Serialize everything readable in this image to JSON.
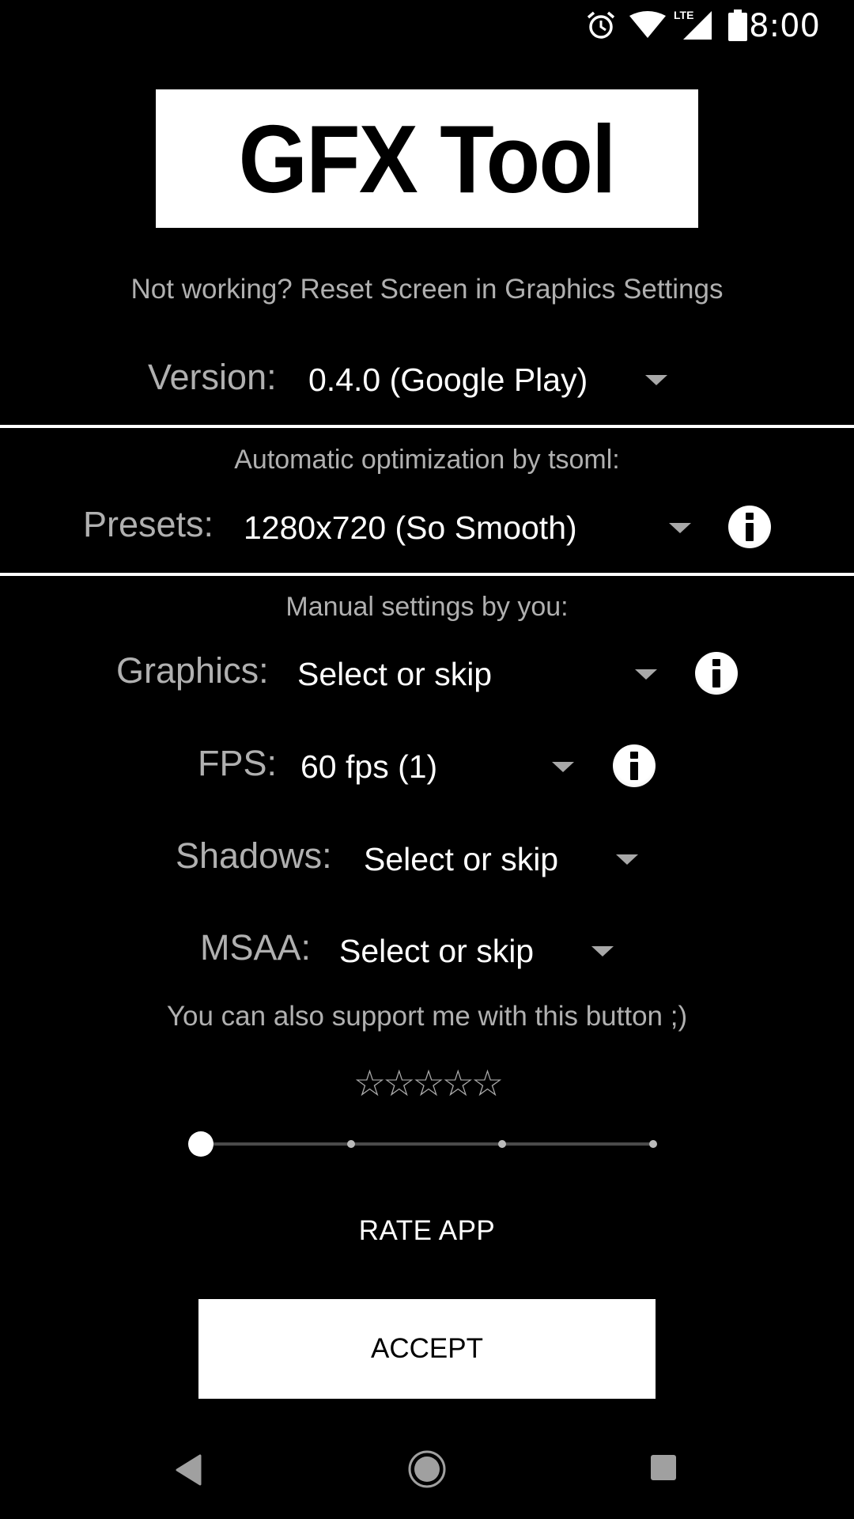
{
  "status_bar": {
    "time": "8:00",
    "icons": [
      "alarm-icon",
      "wifi-icon",
      "lte-signal-icon",
      "battery-icon"
    ],
    "network_label": "LTE"
  },
  "app": {
    "logo_text": "GFX Tool",
    "hint": "Not working? Reset Screen in Graphics Settings"
  },
  "version": {
    "label": "Version:",
    "value": "0.4.0 (Google Play)"
  },
  "auto_section": {
    "caption": "Automatic optimization by tsoml:",
    "presets_label": "Presets:",
    "presets_value": "1280x720 (So Smooth)"
  },
  "manual_section": {
    "caption": "Manual settings by you:",
    "rows": [
      {
        "label": "Graphics:",
        "value": "Select or skip",
        "has_info": true
      },
      {
        "label": "FPS:",
        "value": "60 fps (1)",
        "has_info": true
      },
      {
        "label": "Shadows:",
        "value": "Select or skip",
        "has_info": false
      },
      {
        "label": "MSAA:",
        "value": "Select or skip",
        "has_info": false
      }
    ]
  },
  "support": {
    "text": "You can also support me with this button ;)",
    "stars": "☆☆☆☆☆",
    "rating": 0,
    "rating_max": 5,
    "slider_positions": 4,
    "slider_selected_index": 0
  },
  "buttons": {
    "rate_app": "RATE APP",
    "accept": "ACCEPT"
  },
  "nav_bar": {
    "icons": [
      "back-icon",
      "home-icon",
      "recents-icon"
    ]
  }
}
